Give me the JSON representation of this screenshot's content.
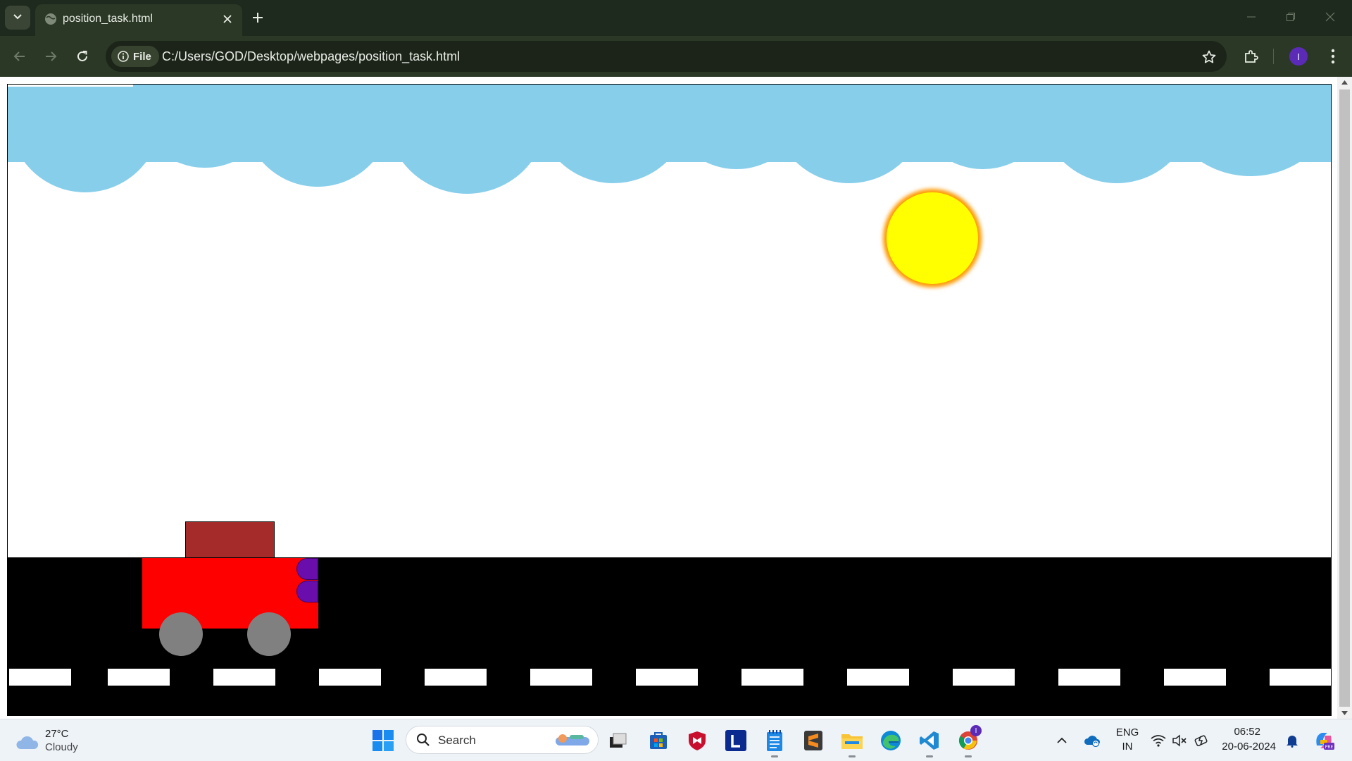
{
  "browser": {
    "tab_title": "position_task.html",
    "url": "C:/Users/GOD/Desktop/webpages/position_task.html",
    "site_chip": "File",
    "profile_initial": "I"
  },
  "scene": {
    "sky_color": "#87CEEB",
    "sun_color": "#FFFF00",
    "sun_glow": "#FF9900",
    "road_color": "#000000",
    "car_body_color": "#FF0000",
    "car_cabin_color": "#A52A2A",
    "headlight_color": "#6A0DAD",
    "wheel_color": "#808080"
  },
  "taskbar": {
    "weather_temp": "27°C",
    "weather_desc": "Cloudy",
    "search_label": "Search",
    "lang_top": "ENG",
    "lang_bottom": "IN",
    "time": "06:52",
    "date": "20-06-2024",
    "chrome_badge": "I"
  }
}
